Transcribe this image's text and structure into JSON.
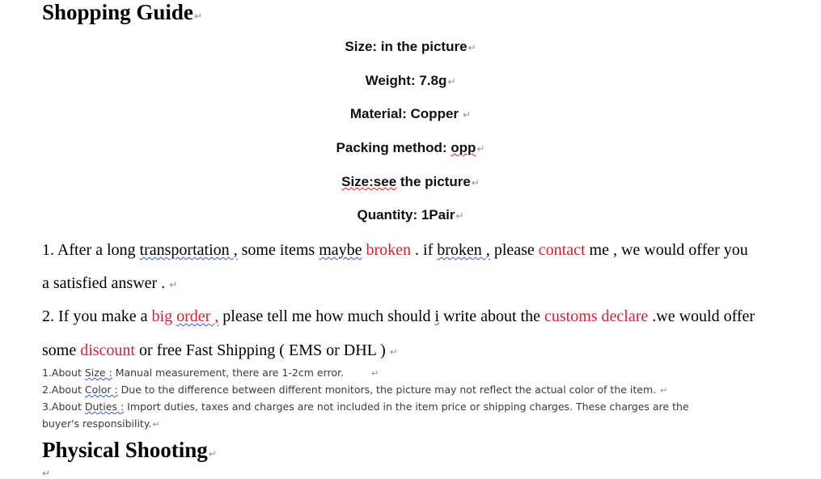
{
  "document": {
    "background_color": "#ffffff",
    "text_color": "#000000",
    "accent_red": "#cf2336",
    "spellcheck_red": "#e02222",
    "grammar_blue": "#3a57c8",
    "return_mark": "↵"
  },
  "headings": {
    "shopping_guide": "Shopping Guide",
    "physical_shooting": "Physical Shooting"
  },
  "specs": [
    {
      "label": "Size:",
      "value": "in the picture",
      "full": "Size: in the picture"
    },
    {
      "label": "Weight:",
      "value": "7.8g",
      "full": "Weight: 7.8g"
    },
    {
      "label": "Material:",
      "value": "Copper",
      "full": "Material: Copper"
    },
    {
      "label": "Packing method:",
      "value": "opp",
      "full": "Packing method: opp"
    },
    {
      "label": "Size:see",
      "value": "the picture",
      "full": "Size:see the picture"
    },
    {
      "label": "Quantity:",
      "value": "1Pair",
      "full": "Quantity: 1Pair"
    }
  ],
  "spec_parts": {
    "packing_prefix": "Packing method: ",
    "packing_opp": "opp",
    "size_see": "Size:see",
    "size_see_rest": " the picture"
  },
  "policies": {
    "item1": {
      "number": "1. ",
      "seg_a": "After a long ",
      "seg_transportation": "transportation ,",
      "seg_b": " some items ",
      "seg_maybe": "maybe",
      "seg_c": " ",
      "seg_broken_red": "broken",
      "seg_d": " . if ",
      "seg_broken2": "broken ,",
      "seg_e": " please ",
      "seg_contact_red": "contact",
      "seg_f": " me , we would offer you",
      "line2": "a satisfied answer ."
    },
    "item2": {
      "number": "2. ",
      "seg_a": "If you make a ",
      "seg_big": "big ",
      "seg_order": "order ,",
      "seg_b": " please tell me how much should ",
      "seg_i": "i",
      "seg_c": " write about the ",
      "seg_customs_red": "customs declare",
      "seg_d": " .we would offer",
      "line2_a": "some ",
      "line2_discount_red": "discount",
      "line2_b": " or free Fast Shipping ( EMS or DHL )"
    }
  },
  "notes": [
    {
      "number": "1.About ",
      "keyword": "Size :",
      "text": " Manual measurement, there are 1-2cm error."
    },
    {
      "number": "2.About ",
      "keyword": "Color :",
      "text": " Due to the difference between different monitors, the picture may not reflect the actual color of the item."
    },
    {
      "number": "3.About ",
      "keyword": "Duties :",
      "text": " Import duties, taxes and charges are not included in the item price or shipping charges. These charges are the",
      "text_wrap": "buyer's responsibility."
    }
  ]
}
